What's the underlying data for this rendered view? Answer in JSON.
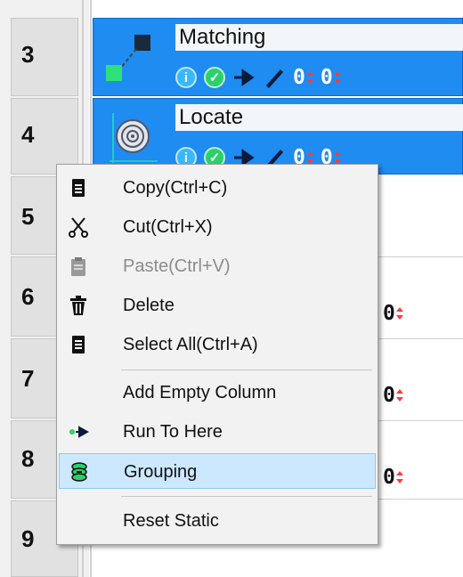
{
  "rows": [
    {
      "num": "3"
    },
    {
      "num": "4"
    },
    {
      "num": "5"
    },
    {
      "num": "6"
    },
    {
      "num": "7"
    },
    {
      "num": "8"
    },
    {
      "num": "9"
    }
  ],
  "steps": [
    {
      "title": "Matching",
      "counter_a": "0",
      "counter_b": "0"
    },
    {
      "title": "Locate",
      "counter_a": "0",
      "counter_b": "0"
    }
  ],
  "info_glyph": "i",
  "check_glyph": "✓",
  "partial_counters": [
    "0",
    "0",
    "0"
  ],
  "context_menu": {
    "items": [
      {
        "label": "Copy(Ctrl+C)",
        "icon": "copy-icon",
        "enabled": true
      },
      {
        "label": "Cut(Ctrl+X)",
        "icon": "cut-icon",
        "enabled": true
      },
      {
        "label": "Paste(Ctrl+V)",
        "icon": "paste-icon",
        "enabled": false
      },
      {
        "label": "Delete",
        "icon": "trash-icon",
        "enabled": true
      },
      {
        "label": "Select All(Ctrl+A)",
        "icon": "select-all-icon",
        "enabled": true
      },
      {
        "label": "Add Empty Column",
        "icon": "",
        "enabled": true
      },
      {
        "label": "Run To Here",
        "icon": "run-to-here-icon",
        "enabled": true
      },
      {
        "label": "Grouping",
        "icon": "grouping-icon",
        "enabled": true,
        "highlighted": true
      },
      {
        "label": "Reset Static",
        "icon": "",
        "enabled": true
      }
    ]
  },
  "colors": {
    "step_card": "#1e8cf0",
    "menu_highlight": "#cce8ff",
    "spinner_arrow": "#ff3b3b"
  }
}
